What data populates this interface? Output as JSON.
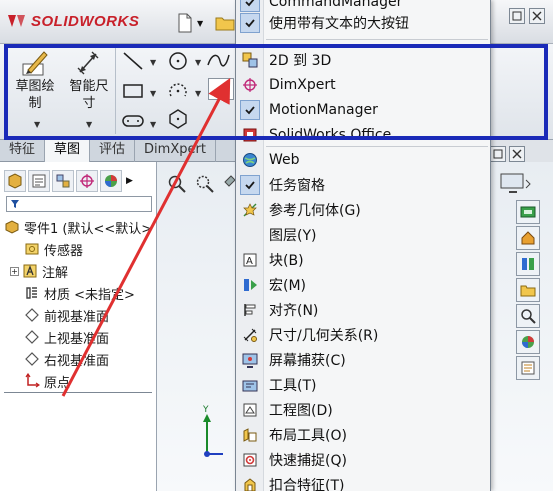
{
  "app": {
    "logo_text": "SOLIDWORKS"
  },
  "ribbon": {
    "sketch_label": "草图绘制",
    "smart_dim_label": "智能尺寸"
  },
  "tabs": [
    {
      "label": "特征"
    },
    {
      "label": "草图"
    },
    {
      "label": "评估"
    },
    {
      "label": "DimXpert"
    }
  ],
  "feature_tree": {
    "part_name": "零件1 (默认<<默认>",
    "items": [
      {
        "label": "传感器"
      },
      {
        "label": "注解"
      },
      {
        "label": "材质 <未指定>"
      },
      {
        "label": "前视基准面"
      },
      {
        "label": "上视基准面"
      },
      {
        "label": "右视基准面"
      },
      {
        "label": "原点"
      }
    ]
  },
  "menu": {
    "items": [
      {
        "label": "CommandManager",
        "checked": true
      },
      {
        "label": "使用带有文本的大按钮",
        "checked": true
      },
      {
        "label": "2D 到 3D",
        "checked": false
      },
      {
        "label": "DimXpert",
        "checked": false
      },
      {
        "label": "MotionManager",
        "checked": true
      },
      {
        "label": "SolidWorks Office",
        "checked": false
      },
      {
        "label": "Web",
        "checked": false
      },
      {
        "label": "任务窗格",
        "checked": true
      },
      {
        "label": "参考几何体(G)",
        "checked": false
      },
      {
        "label": "图层(Y)",
        "checked": false
      },
      {
        "label": "块(B)",
        "checked": false
      },
      {
        "label": "宏(M)",
        "checked": false
      },
      {
        "label": "对齐(N)",
        "checked": false
      },
      {
        "label": "尺寸/几何关系(R)",
        "checked": false
      },
      {
        "label": "屏幕捕获(C)",
        "checked": false
      },
      {
        "label": "工具(T)",
        "checked": false
      },
      {
        "label": "工程图(D)",
        "checked": false
      },
      {
        "label": "布局工具(O)",
        "checked": false
      },
      {
        "label": "快速捕捉(Q)",
        "checked": false
      },
      {
        "label": "扣合特征(T)",
        "checked": false
      }
    ]
  },
  "colors": {
    "highlight_box": "#1a2ab8",
    "arrow": "#e03030",
    "brand": "#c8202a"
  }
}
